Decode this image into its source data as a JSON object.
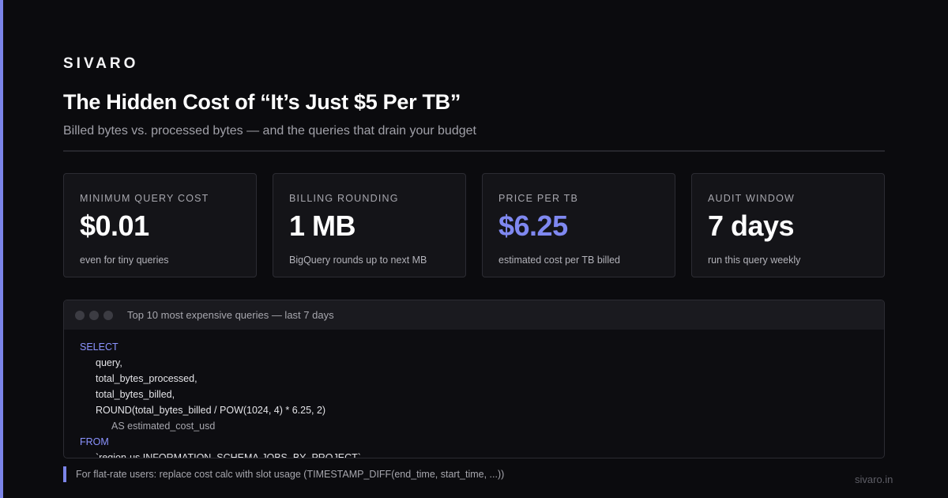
{
  "brand": "SIVARO",
  "header": {
    "title": "The Hidden Cost of “It’s Just $5 Per TB”",
    "subtitle": "Billed bytes vs. processed bytes — and the queries that drain your budget"
  },
  "cards": [
    {
      "label": "MINIMUM QUERY COST",
      "value": "$0.01",
      "caption": "even for tiny queries"
    },
    {
      "label": "BILLING ROUNDING",
      "value": "1 MB",
      "caption": "BigQuery rounds up to next MB"
    },
    {
      "label": "PRICE PER TB",
      "value": "$6.25",
      "caption": "estimated cost per TB billed"
    },
    {
      "label": "AUDIT WINDOW",
      "value": "7 days",
      "caption": "run this query weekly"
    }
  ],
  "code": {
    "title": "Top 10 most expensive queries — last 7 days",
    "lines": [
      "SELECT",
      "query,",
      "total_bytes_processed,",
      "total_bytes_billed,",
      "ROUND(total_bytes_billed / POW(1024, 4) * 6.25, 2)",
      "AS estimated_cost_usd",
      "FROM",
      "`region-us.INFORMATION_SCHEMA.JOBS_BY_PROJECT`"
    ]
  },
  "note": "For flat-rate users: replace cost calc with slot usage (TIMESTAMP_DIFF(end_time, start_time, ...))",
  "footer": {
    "url": "sivaro.in"
  },
  "colors": {
    "accent": "#7b84e8",
    "background": "#0b0b0e",
    "card": "#141418"
  }
}
